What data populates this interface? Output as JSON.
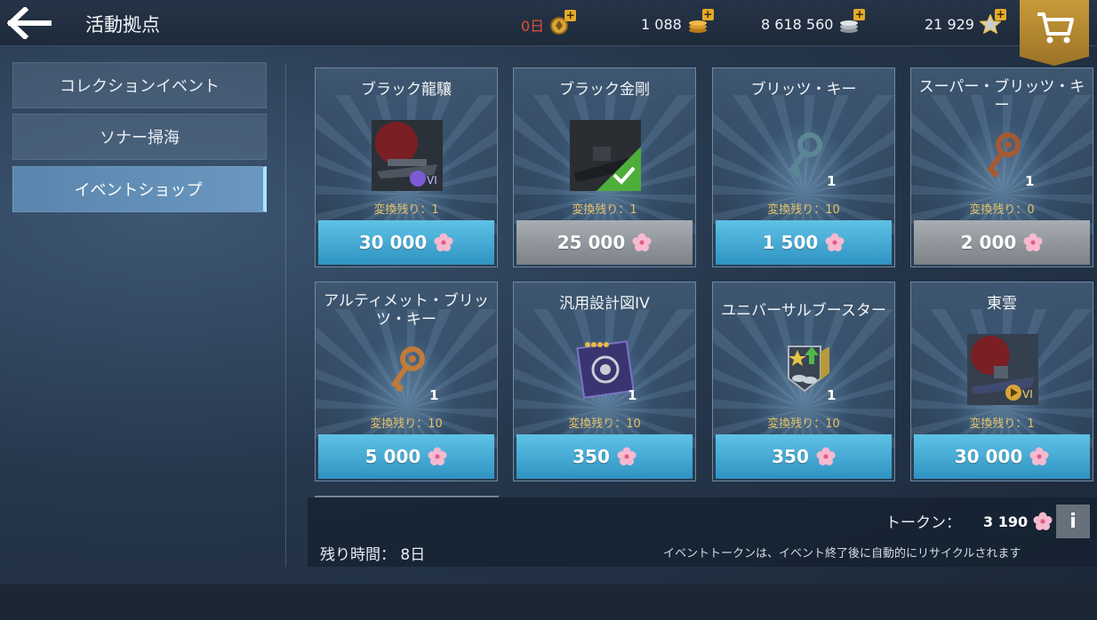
{
  "header": {
    "back_icon": "back-arrow-icon",
    "title": "活動拠点",
    "resources": [
      {
        "name": "days",
        "value": "0日",
        "icon": "premium-icon"
      },
      {
        "name": "gold",
        "value": "1 088",
        "icon": "gold-coins-icon"
      },
      {
        "name": "credits",
        "value": "8 618 560",
        "icon": "silver-coins-icon"
      },
      {
        "name": "free_xp",
        "value": "21 929",
        "icon": "star-icon"
      }
    ],
    "cart_icon": "cart-icon"
  },
  "sidebar": {
    "items": [
      {
        "label": "コレクションイベント",
        "active": false
      },
      {
        "label": "ソナー掃海",
        "active": false
      },
      {
        "label": "イベントショップ",
        "active": true
      }
    ]
  },
  "shop": {
    "items": [
      {
        "title": "ブラック龍驤",
        "remaining": "変換残り：1",
        "price": "30 000",
        "disabled": false,
        "qty": "",
        "icon": "ship-icon",
        "tier": "VI"
      },
      {
        "title": "ブラック金剛",
        "remaining": "変換残り：1",
        "price": "25 000",
        "disabled": true,
        "qty": "",
        "icon": "ship-icon",
        "owned": true
      },
      {
        "title": "ブリッツ・キー",
        "remaining": "変換残り：10",
        "price": "1 500",
        "disabled": false,
        "qty": "1",
        "icon": "key-icon"
      },
      {
        "title": "スーパー・ブリッツ・キー",
        "remaining": "変換残り：0",
        "price": "2 000",
        "disabled": true,
        "qty": "1",
        "icon": "key-icon"
      },
      {
        "title": "アルティメット・ブリッツ・キー",
        "remaining": "変換残り：10",
        "price": "5 000",
        "disabled": false,
        "qty": "1",
        "icon": "key-icon"
      },
      {
        "title": "汎用設計図IV",
        "remaining": "変換残り：10",
        "price": "350",
        "disabled": false,
        "qty": "1",
        "icon": "blueprint-icon"
      },
      {
        "title": "ユニバーサルブースター",
        "remaining": "変換残り：10",
        "price": "350",
        "disabled": false,
        "qty": "1",
        "icon": "booster-icon"
      },
      {
        "title": "東雲",
        "remaining": "変換残り：1",
        "price": "30 000",
        "disabled": false,
        "qty": "",
        "icon": "ship-icon",
        "tier": "VI"
      }
    ]
  },
  "footer": {
    "time_left": "残り時間： 8日",
    "token_label": "トークン：",
    "token_value": "3 190",
    "info_label": "i",
    "recycle_note": "イベントトークンは、イベント終了後に自動的にリサイクルされます"
  },
  "colors": {
    "accent": "#4aaad6",
    "disabled": "#8c9298",
    "gold": "#e6c36a",
    "alert": "#e1513a"
  }
}
